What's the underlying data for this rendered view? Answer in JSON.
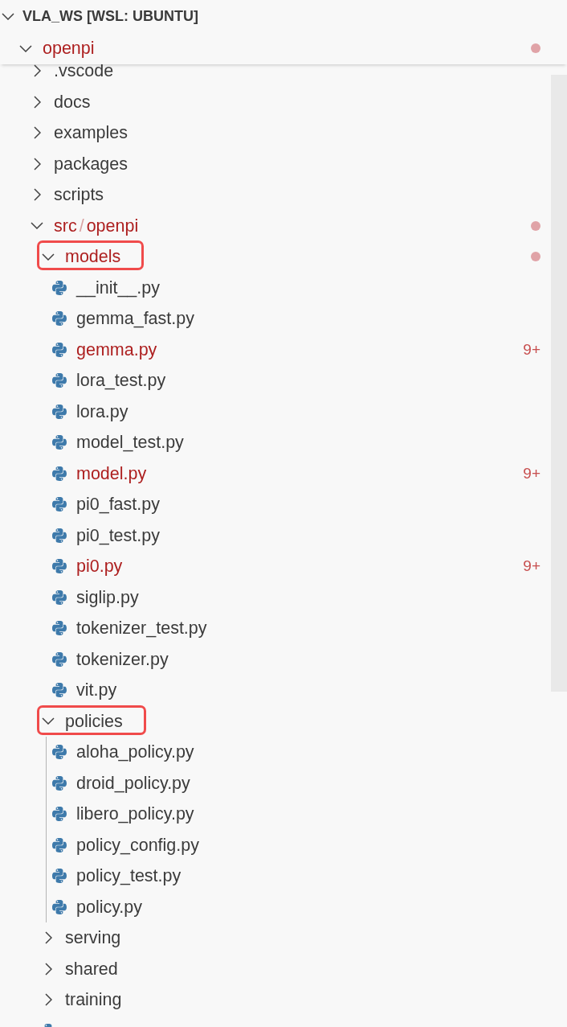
{
  "explorer": {
    "title": "VLA_WS [WSL: UBUNTU]",
    "expanded": true,
    "tree": [
      {
        "kind": "folder",
        "name": "openpi",
        "expanded": true,
        "error": true,
        "highlighted": false,
        "guide": false,
        "children": [
          {
            "kind": "folder",
            "name": ".vscode",
            "expanded": false,
            "error": false,
            "highlighted": false
          },
          {
            "kind": "folder",
            "name": "docs",
            "expanded": false,
            "error": false,
            "highlighted": false
          },
          {
            "kind": "folder",
            "name": "examples",
            "expanded": false,
            "error": false,
            "highlighted": false
          },
          {
            "kind": "folder",
            "name": "packages",
            "expanded": false,
            "error": false,
            "highlighted": false
          },
          {
            "kind": "folder",
            "name": "scripts",
            "expanded": false,
            "error": false,
            "highlighted": false
          },
          {
            "kind": "folder",
            "name_parts": [
              "src",
              "openpi"
            ],
            "separator": "/",
            "expanded": true,
            "error": true,
            "highlighted": false,
            "guide": false,
            "children": [
              {
                "kind": "folder",
                "name": "models",
                "expanded": true,
                "error": true,
                "highlighted": true,
                "guide": false,
                "children": [
                  {
                    "kind": "file",
                    "name": "__init__.py",
                    "error": false
                  },
                  {
                    "kind": "file",
                    "name": "gemma_fast.py",
                    "error": false
                  },
                  {
                    "kind": "file",
                    "name": "gemma.py",
                    "error": true,
                    "badge": "9+"
                  },
                  {
                    "kind": "file",
                    "name": "lora_test.py",
                    "error": false
                  },
                  {
                    "kind": "file",
                    "name": "lora.py",
                    "error": false
                  },
                  {
                    "kind": "file",
                    "name": "model_test.py",
                    "error": false
                  },
                  {
                    "kind": "file",
                    "name": "model.py",
                    "error": true,
                    "badge": "9+"
                  },
                  {
                    "kind": "file",
                    "name": "pi0_fast.py",
                    "error": false
                  },
                  {
                    "kind": "file",
                    "name": "pi0_test.py",
                    "error": false
                  },
                  {
                    "kind": "file",
                    "name": "pi0.py",
                    "error": true,
                    "badge": "9+"
                  },
                  {
                    "kind": "file",
                    "name": "siglip.py",
                    "error": false
                  },
                  {
                    "kind": "file",
                    "name": "tokenizer_test.py",
                    "error": false
                  },
                  {
                    "kind": "file",
                    "name": "tokenizer.py",
                    "error": false
                  },
                  {
                    "kind": "file",
                    "name": "vit.py",
                    "error": false
                  }
                ]
              },
              {
                "kind": "folder",
                "name": "policies",
                "expanded": true,
                "error": false,
                "highlighted": true,
                "guide": true,
                "children": [
                  {
                    "kind": "file",
                    "name": "aloha_policy.py",
                    "error": false
                  },
                  {
                    "kind": "file",
                    "name": "droid_policy.py",
                    "error": false
                  },
                  {
                    "kind": "file",
                    "name": "libero_policy.py",
                    "error": false
                  },
                  {
                    "kind": "file",
                    "name": "policy_config.py",
                    "error": false
                  },
                  {
                    "kind": "file",
                    "name": "policy_test.py",
                    "error": false
                  },
                  {
                    "kind": "file",
                    "name": "policy.py",
                    "error": false
                  }
                ]
              },
              {
                "kind": "folder",
                "name": "serving",
                "expanded": false,
                "error": false,
                "highlighted": false
              },
              {
                "kind": "folder",
                "name": "shared",
                "expanded": false,
                "error": false,
                "highlighted": false
              },
              {
                "kind": "folder",
                "name": "training",
                "expanded": false,
                "error": false,
                "highlighted": false
              },
              {
                "kind": "file"
              }
            ]
          }
        ]
      }
    ]
  }
}
